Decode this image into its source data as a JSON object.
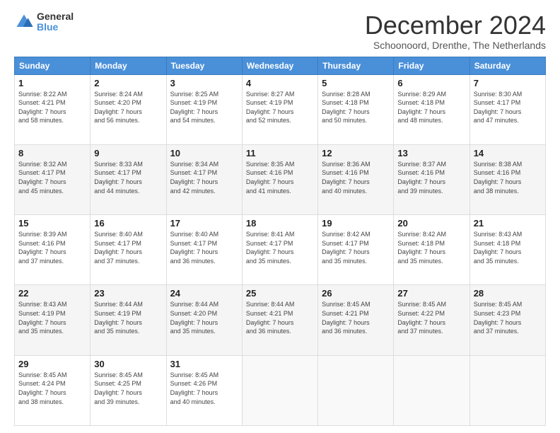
{
  "logo": {
    "general": "General",
    "blue": "Blue"
  },
  "header": {
    "title": "December 2024",
    "subtitle": "Schoonoord, Drenthe, The Netherlands"
  },
  "weekdays": [
    "Sunday",
    "Monday",
    "Tuesday",
    "Wednesday",
    "Thursday",
    "Friday",
    "Saturday"
  ],
  "weeks": [
    [
      {
        "day": "1",
        "info": "Sunrise: 8:22 AM\nSunset: 4:21 PM\nDaylight: 7 hours\nand 58 minutes."
      },
      {
        "day": "2",
        "info": "Sunrise: 8:24 AM\nSunset: 4:20 PM\nDaylight: 7 hours\nand 56 minutes."
      },
      {
        "day": "3",
        "info": "Sunrise: 8:25 AM\nSunset: 4:19 PM\nDaylight: 7 hours\nand 54 minutes."
      },
      {
        "day": "4",
        "info": "Sunrise: 8:27 AM\nSunset: 4:19 PM\nDaylight: 7 hours\nand 52 minutes."
      },
      {
        "day": "5",
        "info": "Sunrise: 8:28 AM\nSunset: 4:18 PM\nDaylight: 7 hours\nand 50 minutes."
      },
      {
        "day": "6",
        "info": "Sunrise: 8:29 AM\nSunset: 4:18 PM\nDaylight: 7 hours\nand 48 minutes."
      },
      {
        "day": "7",
        "info": "Sunrise: 8:30 AM\nSunset: 4:17 PM\nDaylight: 7 hours\nand 47 minutes."
      }
    ],
    [
      {
        "day": "8",
        "info": "Sunrise: 8:32 AM\nSunset: 4:17 PM\nDaylight: 7 hours\nand 45 minutes."
      },
      {
        "day": "9",
        "info": "Sunrise: 8:33 AM\nSunset: 4:17 PM\nDaylight: 7 hours\nand 44 minutes."
      },
      {
        "day": "10",
        "info": "Sunrise: 8:34 AM\nSunset: 4:17 PM\nDaylight: 7 hours\nand 42 minutes."
      },
      {
        "day": "11",
        "info": "Sunrise: 8:35 AM\nSunset: 4:16 PM\nDaylight: 7 hours\nand 41 minutes."
      },
      {
        "day": "12",
        "info": "Sunrise: 8:36 AM\nSunset: 4:16 PM\nDaylight: 7 hours\nand 40 minutes."
      },
      {
        "day": "13",
        "info": "Sunrise: 8:37 AM\nSunset: 4:16 PM\nDaylight: 7 hours\nand 39 minutes."
      },
      {
        "day": "14",
        "info": "Sunrise: 8:38 AM\nSunset: 4:16 PM\nDaylight: 7 hours\nand 38 minutes."
      }
    ],
    [
      {
        "day": "15",
        "info": "Sunrise: 8:39 AM\nSunset: 4:16 PM\nDaylight: 7 hours\nand 37 minutes."
      },
      {
        "day": "16",
        "info": "Sunrise: 8:40 AM\nSunset: 4:17 PM\nDaylight: 7 hours\nand 37 minutes."
      },
      {
        "day": "17",
        "info": "Sunrise: 8:40 AM\nSunset: 4:17 PM\nDaylight: 7 hours\nand 36 minutes."
      },
      {
        "day": "18",
        "info": "Sunrise: 8:41 AM\nSunset: 4:17 PM\nDaylight: 7 hours\nand 35 minutes."
      },
      {
        "day": "19",
        "info": "Sunrise: 8:42 AM\nSunset: 4:17 PM\nDaylight: 7 hours\nand 35 minutes."
      },
      {
        "day": "20",
        "info": "Sunrise: 8:42 AM\nSunset: 4:18 PM\nDaylight: 7 hours\nand 35 minutes."
      },
      {
        "day": "21",
        "info": "Sunrise: 8:43 AM\nSunset: 4:18 PM\nDaylight: 7 hours\nand 35 minutes."
      }
    ],
    [
      {
        "day": "22",
        "info": "Sunrise: 8:43 AM\nSunset: 4:19 PM\nDaylight: 7 hours\nand 35 minutes."
      },
      {
        "day": "23",
        "info": "Sunrise: 8:44 AM\nSunset: 4:19 PM\nDaylight: 7 hours\nand 35 minutes."
      },
      {
        "day": "24",
        "info": "Sunrise: 8:44 AM\nSunset: 4:20 PM\nDaylight: 7 hours\nand 35 minutes."
      },
      {
        "day": "25",
        "info": "Sunrise: 8:44 AM\nSunset: 4:21 PM\nDaylight: 7 hours\nand 36 minutes."
      },
      {
        "day": "26",
        "info": "Sunrise: 8:45 AM\nSunset: 4:21 PM\nDaylight: 7 hours\nand 36 minutes."
      },
      {
        "day": "27",
        "info": "Sunrise: 8:45 AM\nSunset: 4:22 PM\nDaylight: 7 hours\nand 37 minutes."
      },
      {
        "day": "28",
        "info": "Sunrise: 8:45 AM\nSunset: 4:23 PM\nDaylight: 7 hours\nand 37 minutes."
      }
    ],
    [
      {
        "day": "29",
        "info": "Sunrise: 8:45 AM\nSunset: 4:24 PM\nDaylight: 7 hours\nand 38 minutes."
      },
      {
        "day": "30",
        "info": "Sunrise: 8:45 AM\nSunset: 4:25 PM\nDaylight: 7 hours\nand 39 minutes."
      },
      {
        "day": "31",
        "info": "Sunrise: 8:45 AM\nSunset: 4:26 PM\nDaylight: 7 hours\nand 40 minutes."
      },
      {
        "day": "",
        "info": ""
      },
      {
        "day": "",
        "info": ""
      },
      {
        "day": "",
        "info": ""
      },
      {
        "day": "",
        "info": ""
      }
    ]
  ]
}
